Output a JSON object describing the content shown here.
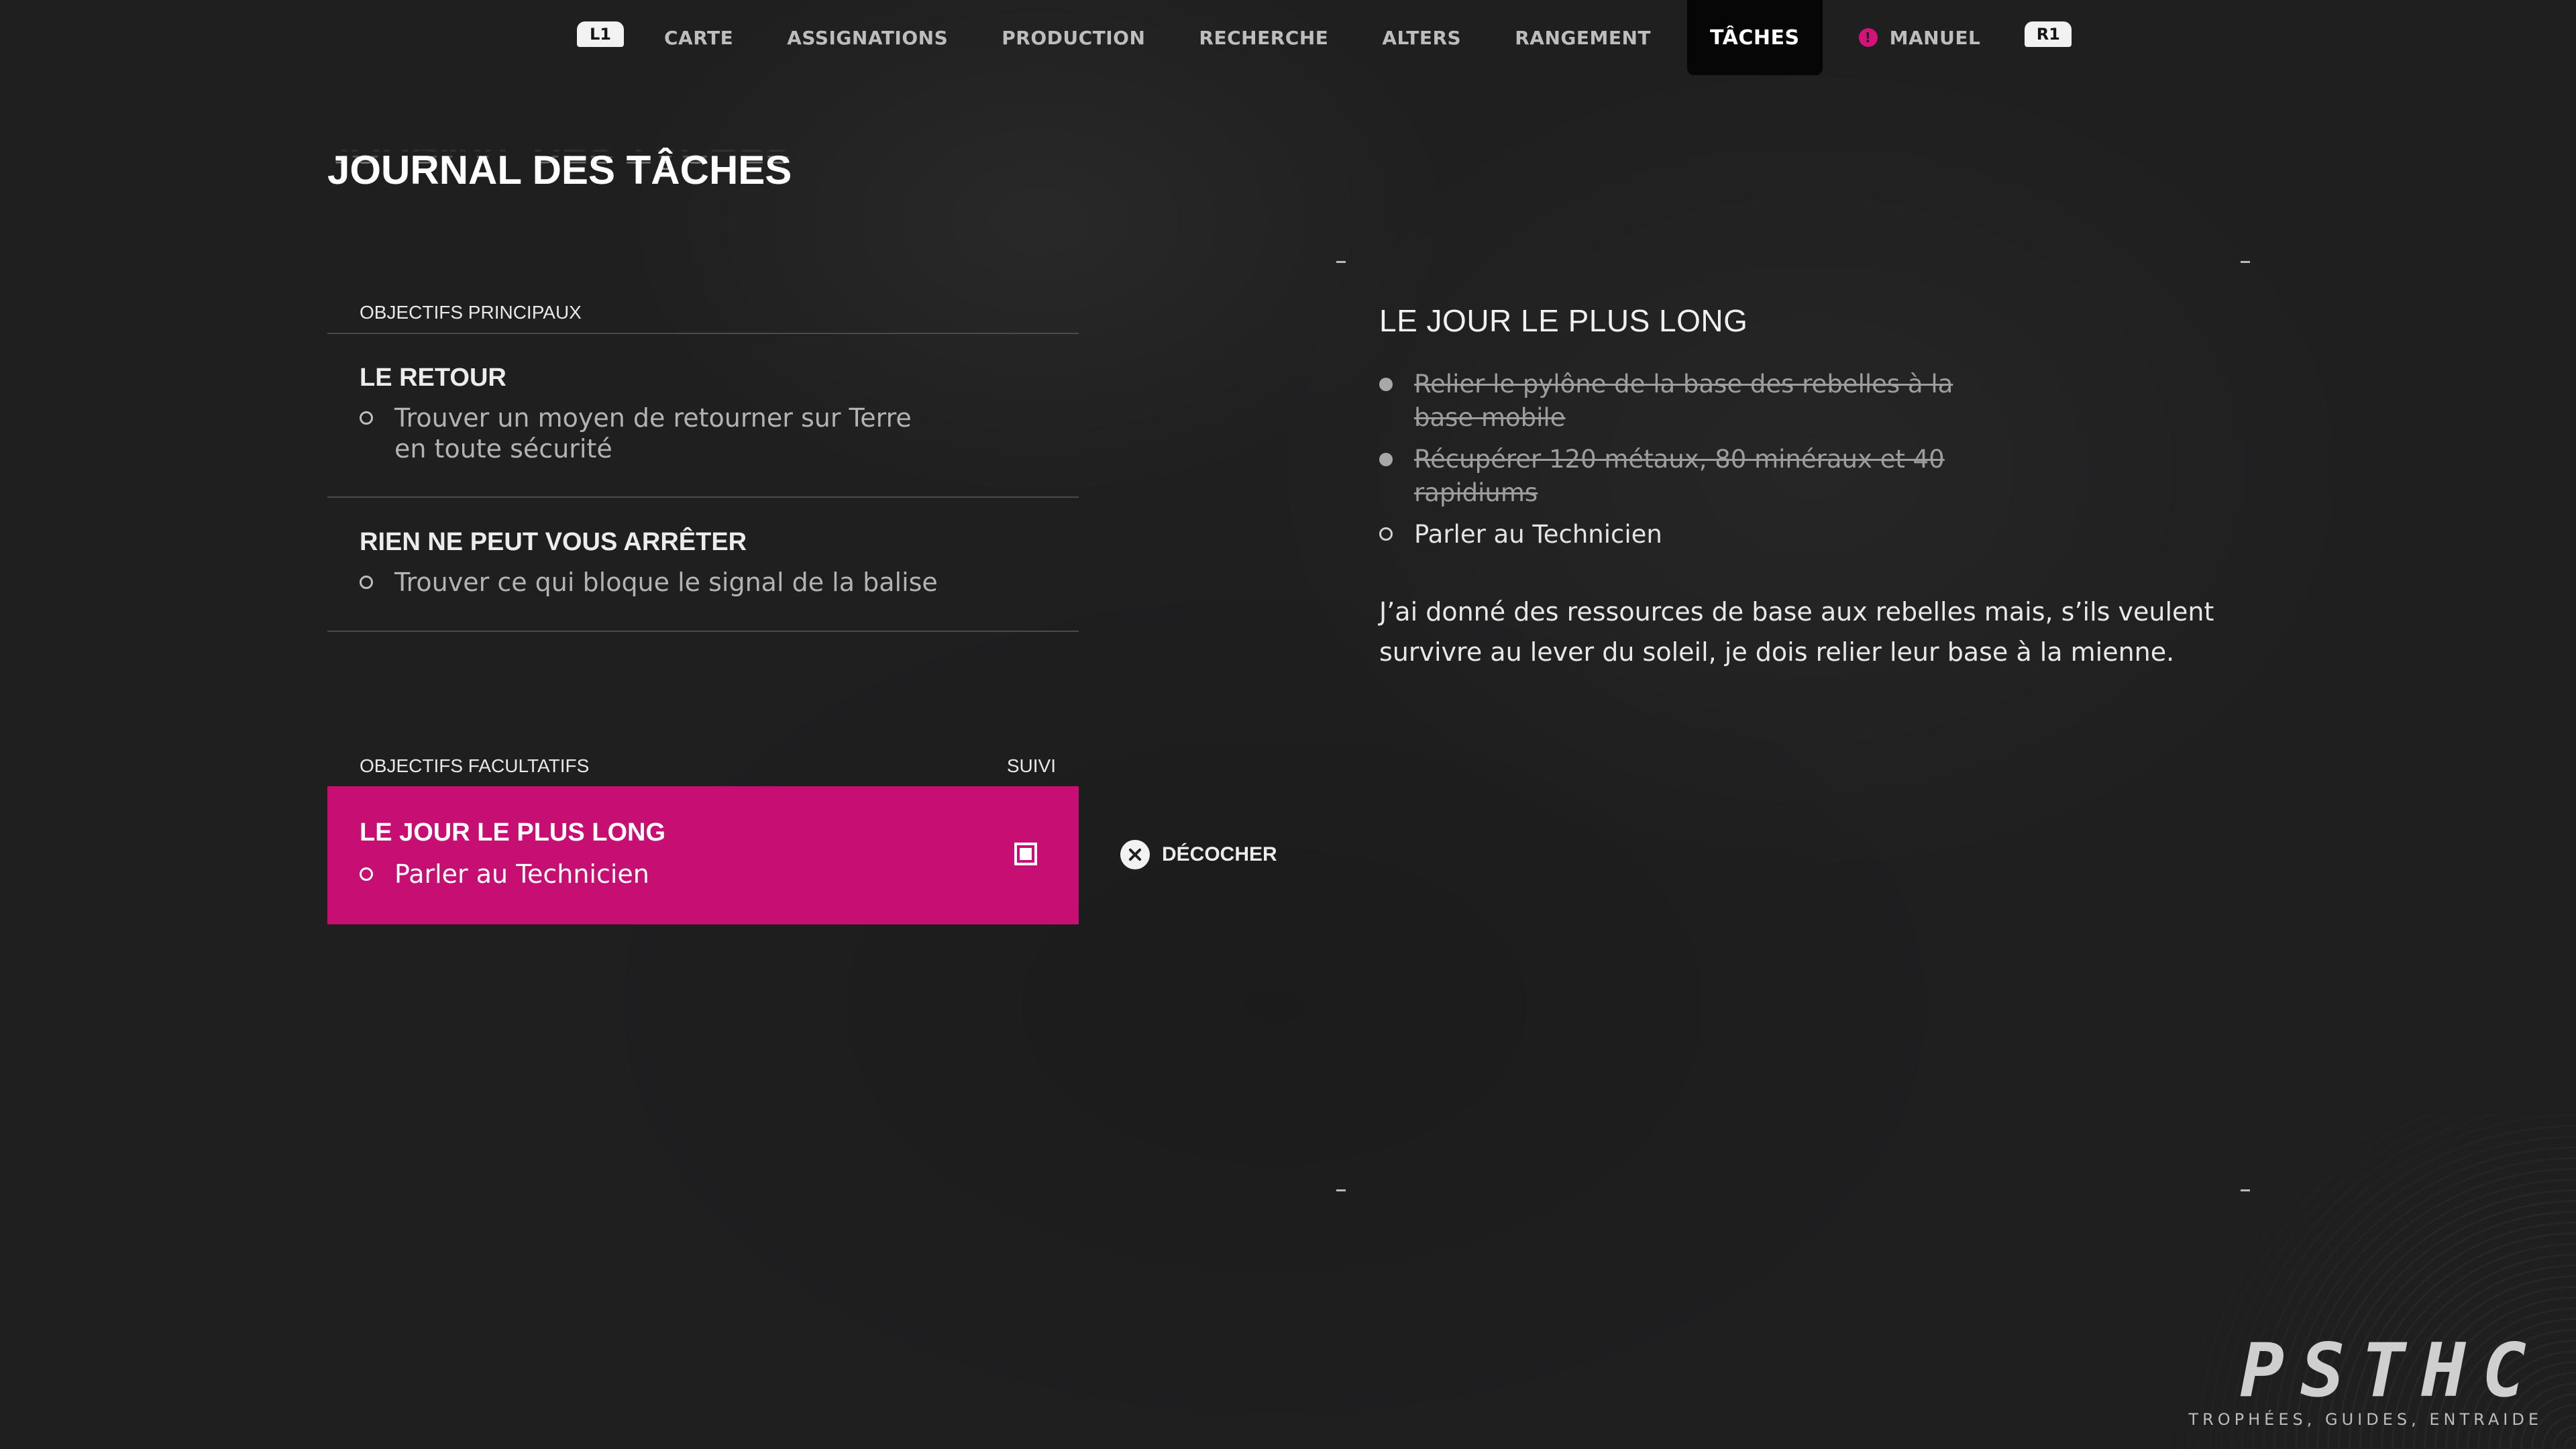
{
  "nav": {
    "left_shoulder": "L1",
    "right_shoulder": "R1",
    "tabs": [
      {
        "label": "CARTE"
      },
      {
        "label": "ASSIGNATIONS"
      },
      {
        "label": "PRODUCTION"
      },
      {
        "label": "RECHERCHE"
      },
      {
        "label": "ALTERS"
      },
      {
        "label": "RANGEMENT"
      },
      {
        "label": "TÂCHES",
        "active": true
      },
      {
        "label": "MANUEL",
        "alert": "!"
      }
    ]
  },
  "page_title": "JOURNAL DES TÂCHES",
  "main_objectives": {
    "header": "OBJECTIFS PRINCIPAUX",
    "quests": [
      {
        "title": "LE RETOUR",
        "objective": "Trouver un moyen de retourner sur Terre en toute sécurité"
      },
      {
        "title": "RIEN NE PEUT VOUS ARRÊTER",
        "objective": "Trouver ce qui bloque le signal de la balise"
      }
    ]
  },
  "optional_objectives": {
    "header": "OBJECTIFS FACULTATIFS",
    "tracked_label": "SUIVI",
    "quests": [
      {
        "title": "LE JOUR LE PLUS LONG",
        "objective": "Parler au Technicien",
        "tracked": true
      }
    ]
  },
  "actions": {
    "uncheck_label": "DÉCOCHER",
    "uncheck_icon": "cross-button-icon"
  },
  "detail": {
    "title": "LE JOUR LE PLUS LONG",
    "steps": [
      {
        "text": "Relier le pylône de la base des rebelles à la base mobile",
        "done": true
      },
      {
        "text": "Récupérer 120 métaux, 80 minéraux et 40 rapidiums",
        "done": true
      },
      {
        "text": "Parler au Technicien",
        "done": false
      }
    ],
    "description": "J’ai donné des ressources de base aux rebelles mais, s’ils veulent survivre au lever du soleil, je dois relier leur base à la mienne."
  },
  "watermark": {
    "logo": "PSTHC",
    "tagline": "TROPHÉES, GUIDES, ENTRAIDE"
  },
  "colors": {
    "background": "#1f1f20",
    "accent": "#c70e72",
    "active_tab": "#060606"
  }
}
